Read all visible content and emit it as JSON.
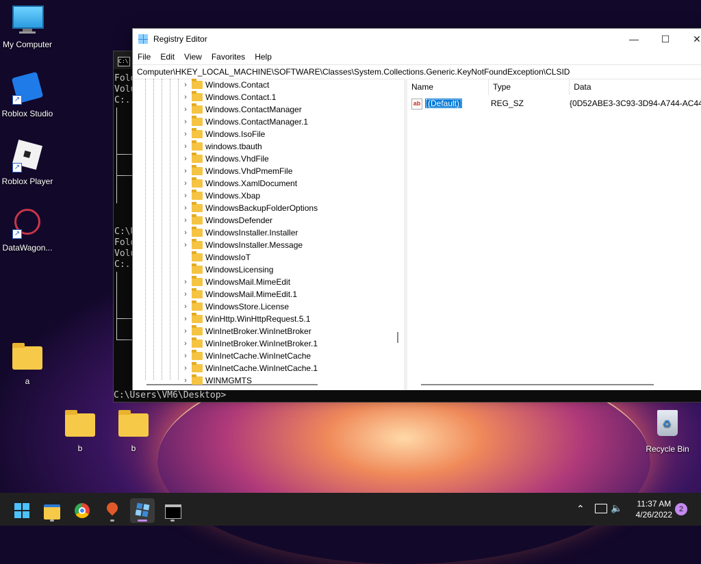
{
  "desktop": {
    "icons": [
      {
        "label": "My Computer"
      },
      {
        "label": "Roblox Studio"
      },
      {
        "label": "Roblox Player"
      },
      {
        "label": "DataWagon..."
      },
      {
        "label": "a"
      },
      {
        "label": "b"
      },
      {
        "label": "b"
      },
      {
        "label": "Recycle Bin"
      }
    ]
  },
  "cmd": {
    "icon_text": "C:\\",
    "lines": [
      "Fold",
      "Volu",
      "C:.",
      "C:\\U",
      "Fold",
      "Volu",
      "C:."
    ],
    "prompt": "C:\\Users\\VM6\\Desktop>"
  },
  "regedit": {
    "title": "Registry Editor",
    "menu": [
      "File",
      "Edit",
      "View",
      "Favorites",
      "Help"
    ],
    "address": "Computer\\HKEY_LOCAL_MACHINE\\SOFTWARE\\Classes\\System.Collections.Generic.KeyNotFoundException\\CLSID",
    "tree_items": [
      {
        "label": "Windows.Contact",
        "expandable": true
      },
      {
        "label": "Windows.Contact.1",
        "expandable": true
      },
      {
        "label": "Windows.ContactManager",
        "expandable": true
      },
      {
        "label": "Windows.ContactManager.1",
        "expandable": true
      },
      {
        "label": "Windows.IsoFile",
        "expandable": true
      },
      {
        "label": "windows.tbauth",
        "expandable": true
      },
      {
        "label": "Windows.VhdFile",
        "expandable": true
      },
      {
        "label": "Windows.VhdPmemFile",
        "expandable": true
      },
      {
        "label": "Windows.XamlDocument",
        "expandable": true
      },
      {
        "label": "Windows.Xbap",
        "expandable": true
      },
      {
        "label": "WindowsBackupFolderOptions",
        "expandable": true
      },
      {
        "label": "WindowsDefender",
        "expandable": true
      },
      {
        "label": "WindowsInstaller.Installer",
        "expandable": true
      },
      {
        "label": "WindowsInstaller.Message",
        "expandable": true
      },
      {
        "label": "WindowsIoT",
        "expandable": false
      },
      {
        "label": "WindowsLicensing",
        "expandable": false
      },
      {
        "label": "WindowsMail.MimeEdit",
        "expandable": true
      },
      {
        "label": "WindowsMail.MimeEdit.1",
        "expandable": true
      },
      {
        "label": "WindowsStore.License",
        "expandable": true
      },
      {
        "label": "WinHttp.WinHttpRequest.5.1",
        "expandable": true
      },
      {
        "label": "WinInetBroker.WinInetBroker",
        "expandable": true
      },
      {
        "label": "WinInetBroker.WinInetBroker.1",
        "expandable": true
      },
      {
        "label": "WinInetCache.WinInetCache",
        "expandable": true
      },
      {
        "label": "WinInetCache.WinInetCache.1",
        "expandable": true
      },
      {
        "label": "WINMGMTS",
        "expandable": true
      }
    ],
    "columns": {
      "name": "Name",
      "type": "Type",
      "data": "Data"
    },
    "values": [
      {
        "icon": "ab",
        "name": "(Default)",
        "type": "REG_SZ",
        "data": "{0D52ABE3-3C93-3D94-A744-AC44"
      }
    ]
  },
  "taskbar": {
    "apps": [
      "start-icon",
      "file-explorer-icon",
      "chrome-icon",
      "maps-pin-icon",
      "regedit-icon",
      "terminal-icon"
    ],
    "clock_time": "11:37 AM",
    "clock_date": "4/26/2022",
    "notification_count": "2"
  }
}
